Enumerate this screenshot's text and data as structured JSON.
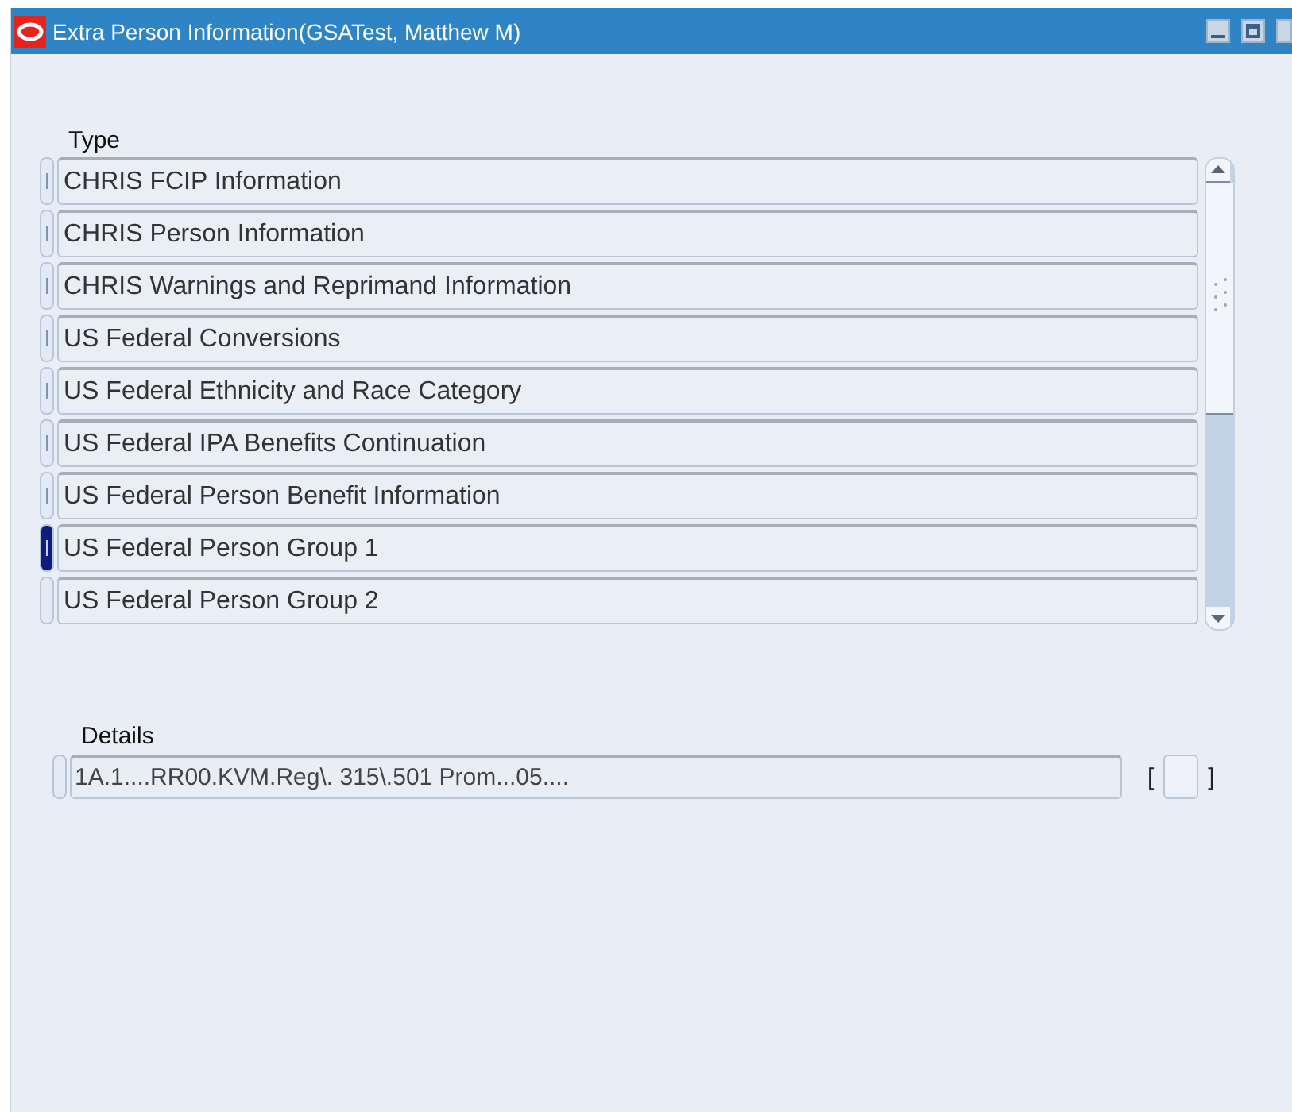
{
  "window": {
    "title": "Extra Person Information(GSATest, Matthew M)"
  },
  "type_list": {
    "heading": "Type",
    "rows": [
      {
        "label": "CHRIS FCIP Information",
        "selected": false,
        "marked": true
      },
      {
        "label": "CHRIS Person Information",
        "selected": false,
        "marked": true
      },
      {
        "label": "CHRIS Warnings and Reprimand Information",
        "selected": false,
        "marked": true
      },
      {
        "label": "US Federal Conversions",
        "selected": false,
        "marked": true
      },
      {
        "label": "US Federal Ethnicity and Race Category",
        "selected": false,
        "marked": true
      },
      {
        "label": "US Federal IPA Benefits Continuation",
        "selected": false,
        "marked": true
      },
      {
        "label": "US Federal Person Benefit Information",
        "selected": false,
        "marked": true
      },
      {
        "label": "US Federal Person Group 1",
        "selected": true,
        "marked": true
      },
      {
        "label": "US Federal Person Group 2",
        "selected": false,
        "marked": false
      }
    ]
  },
  "details": {
    "heading": "Details",
    "value": "1A.1....RR00.KVM.Reg\\. 315\\.501 Prom...05....",
    "open_bracket": "[",
    "close_bracket": "]"
  }
}
